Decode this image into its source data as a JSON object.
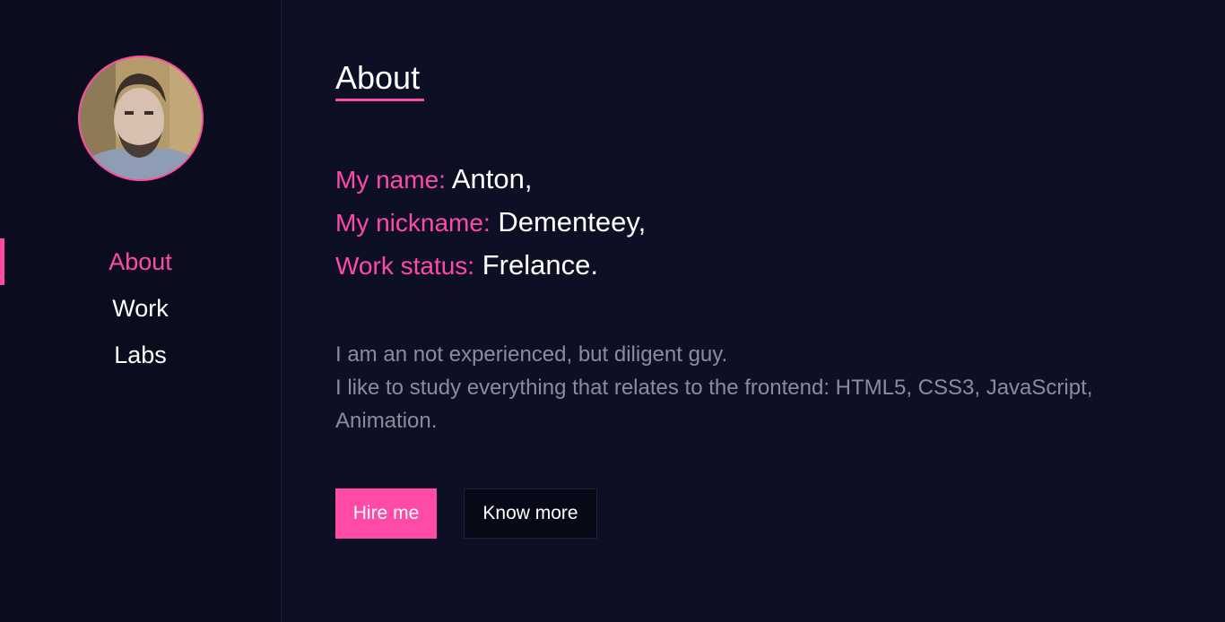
{
  "colors": {
    "accent": "#ff4aa6",
    "background": "#0d1024",
    "sidebar": "#0b0d1f",
    "text": "#ffffff",
    "muted_text": "#8a8d99"
  },
  "sidebar": {
    "avatar_icon": "user-avatar-photo",
    "nav": [
      {
        "label": "About",
        "active": true
      },
      {
        "label": "Work",
        "active": false
      },
      {
        "label": "Labs",
        "active": false
      }
    ]
  },
  "main": {
    "title": "About",
    "facts": [
      {
        "key": "My name:",
        "value": "Anton,"
      },
      {
        "key": "My nickname:",
        "value": "Dementeey,"
      },
      {
        "key": "Work status:",
        "value": "Frelance."
      }
    ],
    "bio": [
      "I am an not experienced, but diligent guy.",
      "I like to study everything that relates to the frontend: HTML5, CSS3, JavaScript,",
      "Animation."
    ],
    "buttons": {
      "hire": "Hire me",
      "more": "Know more"
    }
  }
}
